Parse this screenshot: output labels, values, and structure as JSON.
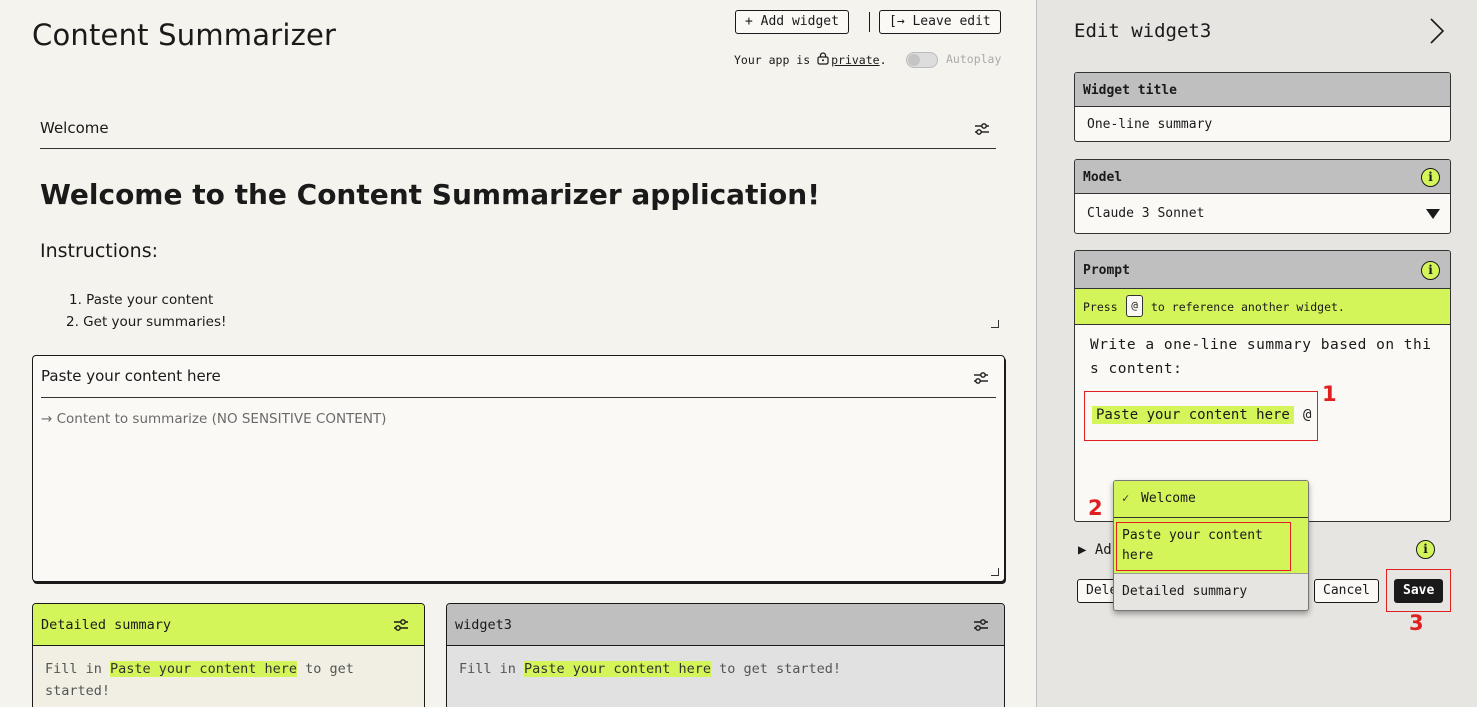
{
  "header": {
    "app_title": "Content Summarizer",
    "add_widget": "+ Add widget",
    "leave_edit": "[→ Leave edit",
    "privacy_prefix": "Your app is ",
    "privacy_link": "private",
    "privacy_suffix": ".",
    "autoplay": "Autoplay",
    "autoplay_on": false
  },
  "welcome_widget": {
    "title": "Welcome",
    "heading": "Welcome to the Content Summarizer application!",
    "subheading": "Instructions:",
    "steps": [
      "1. Paste your content",
      "2. Get your summaries!"
    ]
  },
  "paste_widget": {
    "title": "Paste your content here",
    "placeholder": "→ Content to summarize (NO SENSITIVE CONTENT)"
  },
  "cards": [
    {
      "title": "Detailed summary",
      "body_prefix": "Fill in ",
      "body_ref": "Paste your content here",
      "body_suffix": " to get started!"
    },
    {
      "title": "widget3",
      "body_prefix": "Fill in ",
      "body_ref": "Paste your content here",
      "body_suffix": " to get started!"
    }
  ],
  "panel": {
    "title": "Edit widget3",
    "widget_title_label": "Widget title",
    "widget_title_value": "One-line summary",
    "model_label": "Model",
    "model_value": "Claude 3 Sonnet",
    "prompt_label": "Prompt",
    "hint_prefix": "Press",
    "hint_key": "@",
    "hint_suffix": "to reference another widget.",
    "prompt_text": "Write a one-line summary based on this content:",
    "prompt_chip": "Paste your content here",
    "prompt_cursor": "@",
    "advanced_label": "Ad",
    "delete_label": "Delete",
    "cancel_label": "Cancel",
    "save_label": "Save"
  },
  "reference_menu": {
    "items": [
      {
        "label": "Welcome",
        "checked": true
      },
      {
        "label": "Paste your content here",
        "checked": false
      },
      {
        "label": "Detailed summary",
        "checked": false
      }
    ]
  },
  "annotations": [
    "1",
    "2",
    "3"
  ],
  "colors": {
    "accent": "#d4f55a",
    "background": "#f4f3ee",
    "panel": "#e6e5e1",
    "header_gray": "#bfbfbf",
    "annotation_red": "#e02020",
    "ink": "#1a1a1a"
  }
}
